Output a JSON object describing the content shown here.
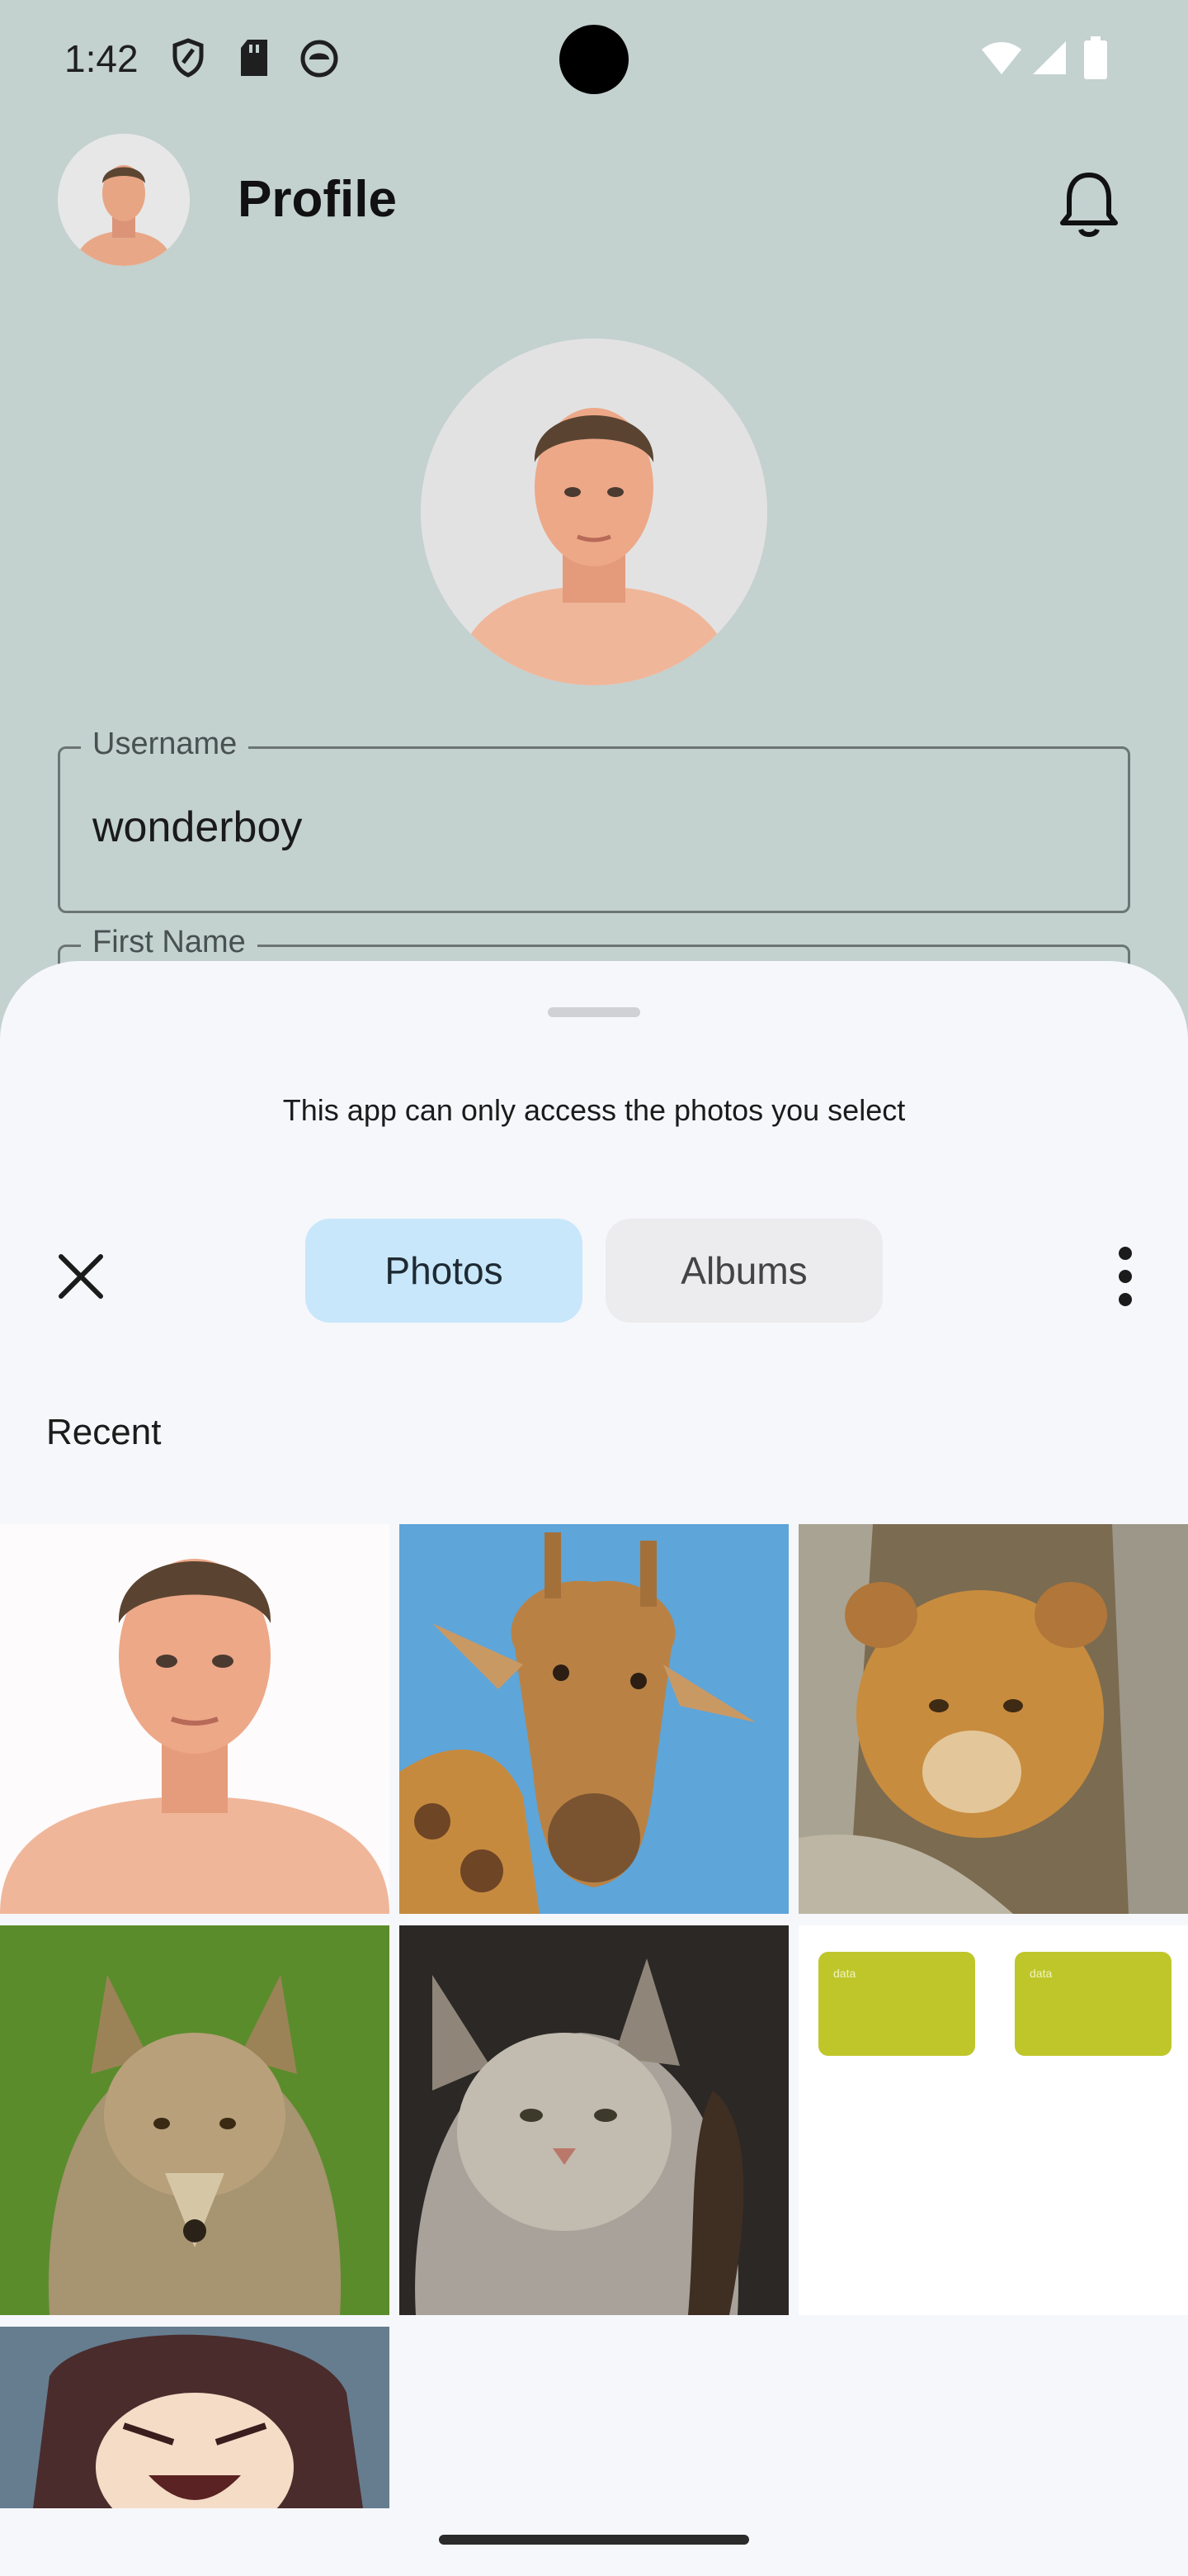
{
  "status_bar": {
    "time": "1:42",
    "left_icons": [
      "shield-icon",
      "sd-card-icon",
      "app-notification-icon"
    ],
    "right_icons": [
      "wifi-icon",
      "signal-icon",
      "battery-icon"
    ]
  },
  "app_bar": {
    "title": "Profile",
    "notification_icon": "bell-icon"
  },
  "form": {
    "username_label": "Username",
    "username_value": "wonderboy",
    "first_name_label": "First Name"
  },
  "photo_picker": {
    "access_note": "This app can only access the photos you select",
    "tabs": [
      {
        "label": "Photos",
        "selected": true
      },
      {
        "label": "Albums",
        "selected": false
      }
    ],
    "close_icon": "close-icon",
    "menu_icon": "more-vertical-icon",
    "section_title": "Recent",
    "items": [
      {
        "name": "photo-man-portrait"
      },
      {
        "name": "photo-giraffe"
      },
      {
        "name": "photo-lion-cub"
      },
      {
        "name": "photo-coyote"
      },
      {
        "name": "photo-lynx"
      },
      {
        "name": "photo-data-cards",
        "card_labels": [
          "data",
          "data"
        ]
      },
      {
        "name": "photo-anime-character"
      }
    ]
  },
  "colors": {
    "background": "#c3d1cf",
    "sheet": "#f6f7fb",
    "tab_selected": "#c8e7fb",
    "tab_unselected": "#ececee",
    "data_card": "#bfc62a"
  }
}
